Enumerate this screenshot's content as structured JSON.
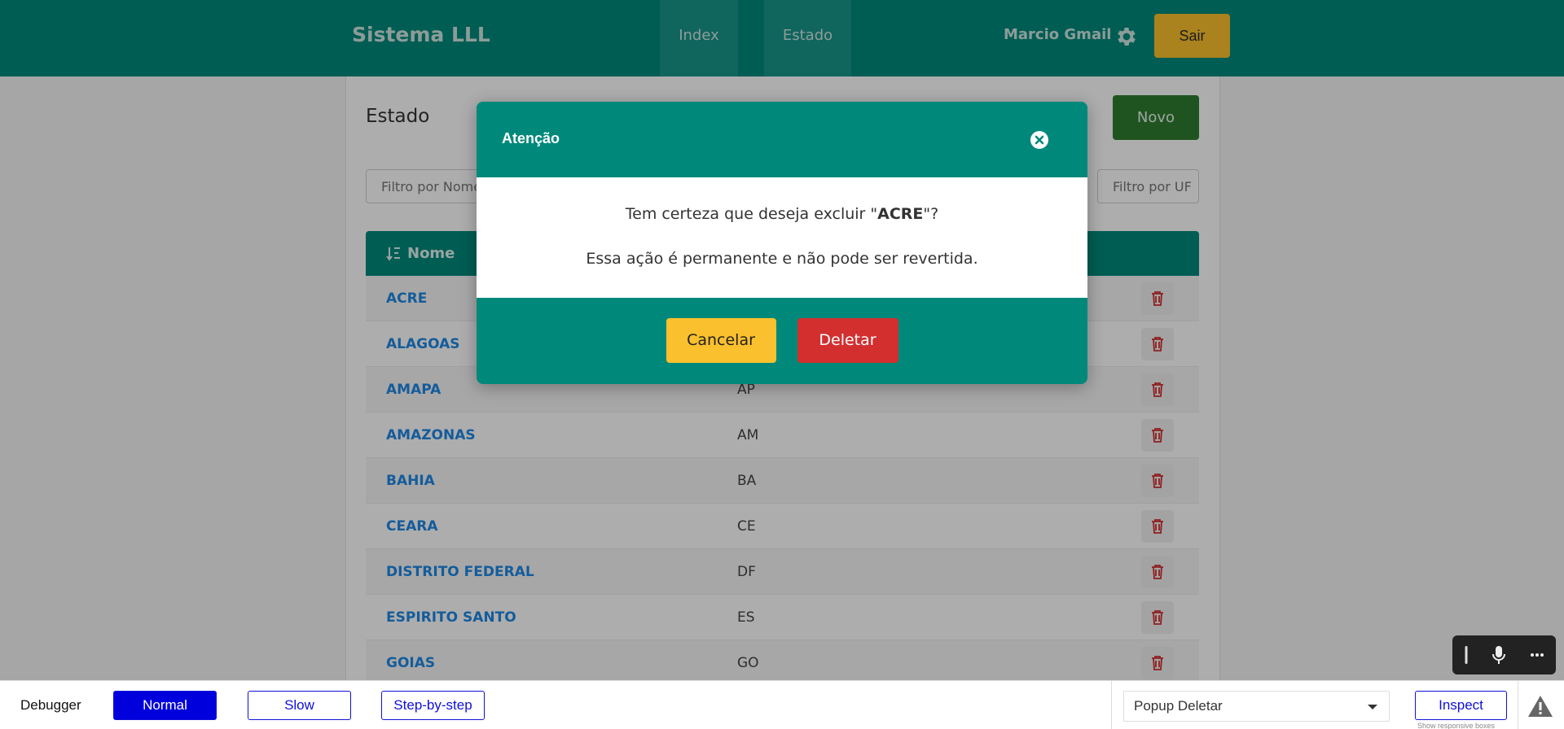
{
  "header": {
    "brand": "Sistema LLL",
    "nav": [
      "Index",
      "Estado"
    ],
    "user": "Marcio Gmail",
    "logout_label": "Sair"
  },
  "page": {
    "title": "Estado",
    "new_label": "Novo",
    "filter_name_placeholder": "Filtro por Nome",
    "filter_uf_placeholder": "Filtro por UF"
  },
  "table": {
    "header_name": "Nome",
    "rows": [
      {
        "nome": "ACRE",
        "uf": ""
      },
      {
        "nome": "ALAGOAS",
        "uf": ""
      },
      {
        "nome": "AMAPA",
        "uf": "AP"
      },
      {
        "nome": "AMAZONAS",
        "uf": "AM"
      },
      {
        "nome": "BAHIA",
        "uf": "BA"
      },
      {
        "nome": "CEARA",
        "uf": "CE"
      },
      {
        "nome": "DISTRITO FEDERAL",
        "uf": "DF"
      },
      {
        "nome": "ESPIRITO SANTO",
        "uf": "ES"
      },
      {
        "nome": "GOIAS",
        "uf": "GO"
      }
    ]
  },
  "modal": {
    "title": "Atenção",
    "question_prefix": "Tem certeza que deseja excluir \"",
    "question_item": "ACRE",
    "question_suffix": "\"?",
    "warning": "Essa ação é permanente e não pode ser revertida.",
    "cancel_label": "Cancelar",
    "delete_label": "Deletar"
  },
  "debugger": {
    "label": "Debugger",
    "modes": [
      "Normal",
      "Slow",
      "Step-by-step"
    ],
    "active_mode": "Normal",
    "selected_scenario": "Popup Deletar",
    "inspect_label": "Inspect",
    "inspect_hint": "Show responsive boxes"
  },
  "colors": {
    "primary": "#00897b",
    "warning": "#fbc02d",
    "danger": "#d32f2f",
    "success": "#2e7d32",
    "link": "#1e88e5",
    "debug_blue": "#0000dd"
  },
  "icons": [
    "gear-icon",
    "sort-alpha-icon",
    "trash-icon",
    "close-circle-icon",
    "mic-icon",
    "more-icon",
    "warning-icon"
  ]
}
